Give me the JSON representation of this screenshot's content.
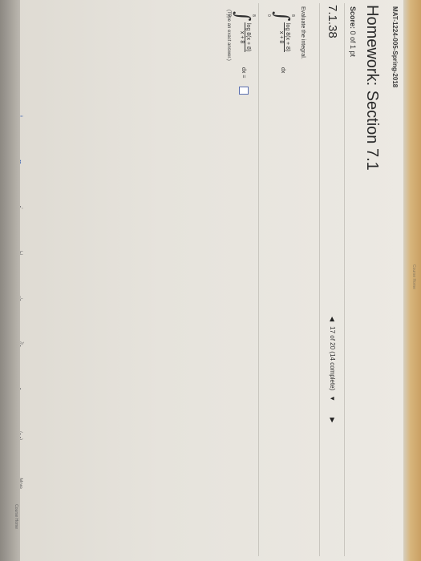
{
  "header": {
    "course_title": "MAT-1224-005-Spring-2018",
    "top_hint": "Course Home",
    "bottom_hint": "Course Home"
  },
  "homework": {
    "title": "Homework: Section 7.1",
    "score_label": "Score:",
    "score_value": "0 of 1 pt"
  },
  "question": {
    "number": "7.1.38",
    "nav_text": "17 of 20 (14 complete)",
    "instruction": "Evaluate the integral.",
    "integral1": {
      "upper": "8",
      "lower": "0",
      "numerator": "log 8(x + 8)",
      "denominator": "x + 8",
      "differential": "dx"
    },
    "integral2": {
      "upper": "8",
      "lower": "0",
      "numerator": "log 8(x + 8)",
      "denominator": "x + 8",
      "differential": "dx ="
    },
    "answer_hint": "(Type an exact answer.)"
  },
  "toolbar": {
    "items": [
      "⁞",
      "▪▪",
      "▪ʼ",
      "|▪|",
      "√▪",
      "∛▪",
      "▪.",
      "(▪,▪)",
      "More"
    ]
  },
  "colors": {
    "answer_border": "#5a6fb0",
    "title_text": "#2b2b2b",
    "page_bg": "#e9e6df"
  }
}
